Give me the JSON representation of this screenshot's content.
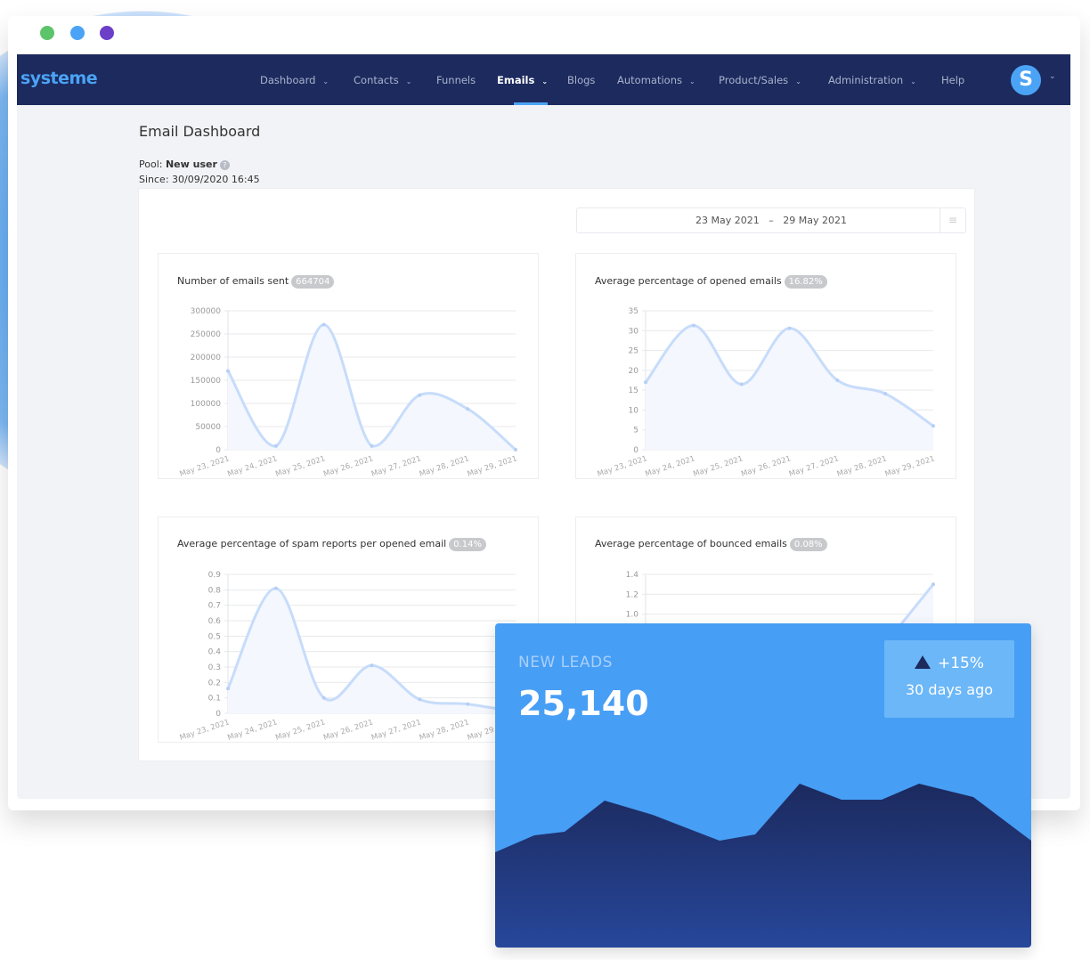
{
  "window": {
    "dots": [
      "#5cc46a",
      "#4ba3f5",
      "#6c3fc9"
    ]
  },
  "nav": {
    "logo": "systeme",
    "items": [
      {
        "label": "Dashboard",
        "dropdown": true
      },
      {
        "label": "Contacts",
        "dropdown": true
      },
      {
        "label": "Funnels",
        "dropdown": false
      },
      {
        "label": "Emails",
        "dropdown": true,
        "active": true
      },
      {
        "label": "Blogs",
        "dropdown": false
      },
      {
        "label": "Automations",
        "dropdown": true
      },
      {
        "label": "Product/Sales",
        "dropdown": true
      },
      {
        "label": "Administration",
        "dropdown": true
      },
      {
        "label": "Help",
        "dropdown": false
      }
    ],
    "avatar_letter": "S",
    "colors": {
      "bar": "#1c2a5e",
      "accent": "#4ba3f5"
    }
  },
  "page": {
    "title": "Email Dashboard",
    "pool_label": "Pool:",
    "pool_value": "New user",
    "since": "Since: 30/09/2020 16:45",
    "date_from": "23 May 2021",
    "date_sep": "–",
    "date_to": "29 May 2021"
  },
  "chart_data": [
    {
      "type": "area",
      "title": "Number of emails sent",
      "badge": "664704",
      "categories": [
        "May 23, 2021",
        "May 24, 2021",
        "May 25, 2021",
        "May 26, 2021",
        "May 27, 2021",
        "May 28, 2021",
        "May 29, 2021"
      ],
      "values": [
        170000,
        8000,
        270000,
        8000,
        118000,
        88000,
        0
      ],
      "yticks": [
        "0",
        "50000",
        "100000",
        "150000",
        "200000",
        "250000",
        "300000"
      ],
      "ylim": [
        0,
        300000
      ],
      "grid": true
    },
    {
      "type": "area",
      "title": "Average percentage of opened emails",
      "badge": "16.82%",
      "categories": [
        "May 23, 2021",
        "May 24, 2021",
        "May 25, 2021",
        "May 26, 2021",
        "May 27, 2021",
        "May 28, 2021",
        "May 29, 2021"
      ],
      "values": [
        17,
        31.3,
        16.5,
        30.6,
        17.5,
        14.1,
        6
      ],
      "yticks": [
        "0",
        "5",
        "10",
        "15",
        "20",
        "25",
        "30",
        "35"
      ],
      "ylim": [
        0,
        35
      ],
      "grid": true
    },
    {
      "type": "area",
      "title": "Average percentage of spam reports per opened email",
      "badge": "0.14%",
      "categories": [
        "May 23, 2021",
        "May 24, 2021",
        "May 25, 2021",
        "May 26, 2021",
        "May 27, 2021",
        "May 28, 2021",
        "May 29, 2021"
      ],
      "values": [
        0.16,
        0.81,
        0.1,
        0.31,
        0.09,
        0.06,
        0.01
      ],
      "yticks": [
        "0",
        "0.1",
        "0.2",
        "0.3",
        "0.4",
        "0.5",
        "0.6",
        "0.7",
        "0.8",
        "0.9"
      ],
      "ylim": [
        0,
        0.9
      ],
      "grid": true
    },
    {
      "type": "area",
      "title": "Average percentage of bounced emails",
      "badge": "0.08%",
      "categories": [],
      "values": [
        null,
        null,
        null,
        null,
        null,
        0.7,
        1.3
      ],
      "yticks": [
        "1.0",
        "1.2",
        "1.4"
      ],
      "ylim": [
        0,
        1.4
      ],
      "grid": true
    }
  ],
  "leads": {
    "label": "NEW LEADS",
    "value": "25,140",
    "delta": "+15%",
    "delta_icon": "triangle-up-icon",
    "period": "30 days ago",
    "colors": {
      "card": "#479ef5",
      "mountain": "#1c2a5e"
    }
  }
}
